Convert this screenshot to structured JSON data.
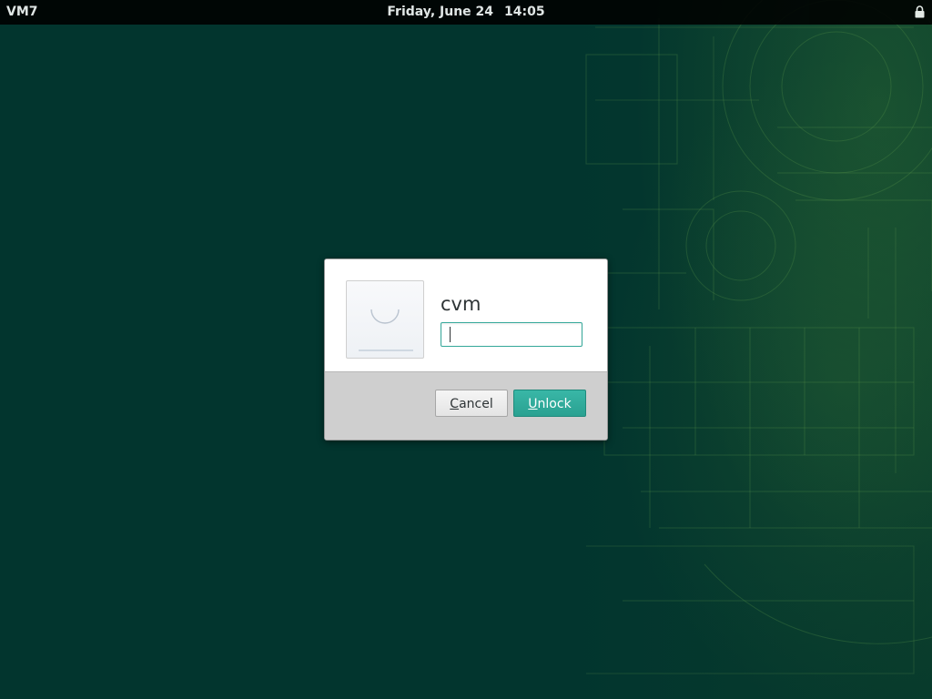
{
  "top_bar": {
    "activities_label": "VM7",
    "date": "Friday, June 24",
    "time": "14:05",
    "status_icon": "lock-icon"
  },
  "unlock_dialog": {
    "avatar_icon": "user-avatar-icon",
    "username": "cvm",
    "password": {
      "value": "",
      "placeholder": ""
    },
    "cancel_button": {
      "mnemonic": "C",
      "rest": "ancel"
    },
    "unlock_button": {
      "mnemonic": "U",
      "rest": "nlock"
    }
  },
  "colors": {
    "desktop_background": "#02352e",
    "top_bar": "#000000",
    "accent": "#35a89a",
    "dialog_action_area": "#cfcfcf"
  }
}
